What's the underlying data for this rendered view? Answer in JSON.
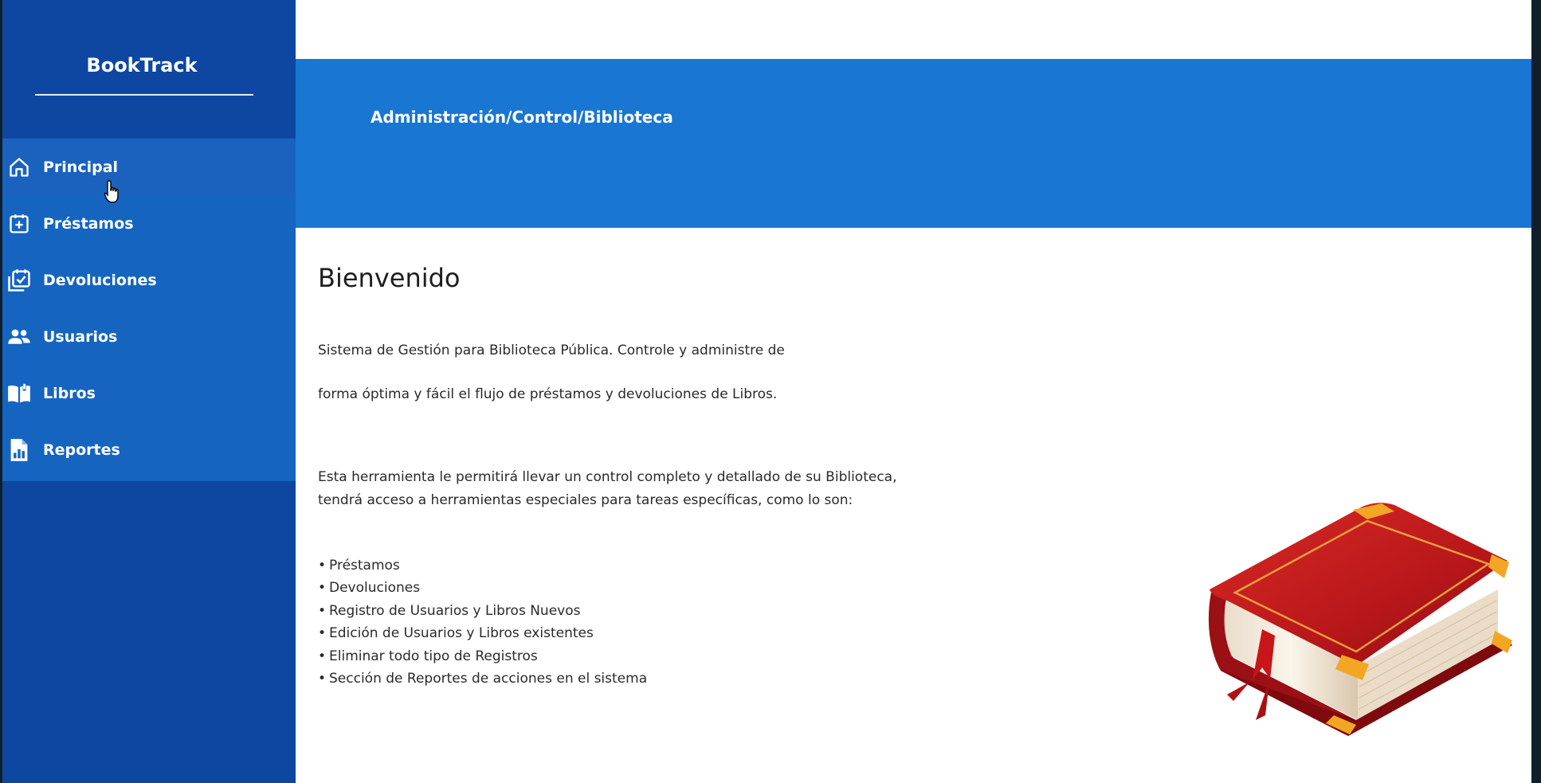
{
  "app": {
    "title": "BookTrack"
  },
  "sidebar": {
    "items": [
      {
        "label": "Principal",
        "icon": "home-icon",
        "active": true
      },
      {
        "label": "Préstamos",
        "icon": "calendar-plus-icon",
        "active": false
      },
      {
        "label": "Devoluciones",
        "icon": "calendar-check-icon",
        "active": false
      },
      {
        "label": "Usuarios",
        "icon": "users-icon",
        "active": false
      },
      {
        "label": "Libros",
        "icon": "open-book-icon",
        "active": false
      },
      {
        "label": "Reportes",
        "icon": "report-document-icon",
        "active": false
      }
    ]
  },
  "header": {
    "breadcrumb": "Administración/Control/Biblioteca"
  },
  "main": {
    "heading": "Bienvenido",
    "paragraph1_line1": "Sistema de Gestión para Biblioteca Pública. Controle y administre de",
    "paragraph1_line2": "forma óptima y fácil el flujo de préstamos y devoluciones de Libros.",
    "paragraph2_line1": "Esta herramienta le permitirá llevar un control completo y detallado de su Biblioteca,",
    "paragraph2_line2": "tendrá acceso a herramientas especiales para tareas específicas, como lo son:",
    "bullet": "•",
    "features": [
      "Préstamos",
      "Devoluciones",
      "Registro de Usuarios y Libros Nuevos",
      "Edición de Usuarios y Libros existentes",
      "Eliminar todo tipo de Registros",
      "Sección de Reportes de acciones en el sistema"
    ]
  },
  "colors": {
    "sidebar_dark": "#0d47a1",
    "sidebar_menu": "#1565c0",
    "header_band": "#1976d2",
    "book_red": "#c0181c",
    "book_gold": "#f0a020"
  }
}
